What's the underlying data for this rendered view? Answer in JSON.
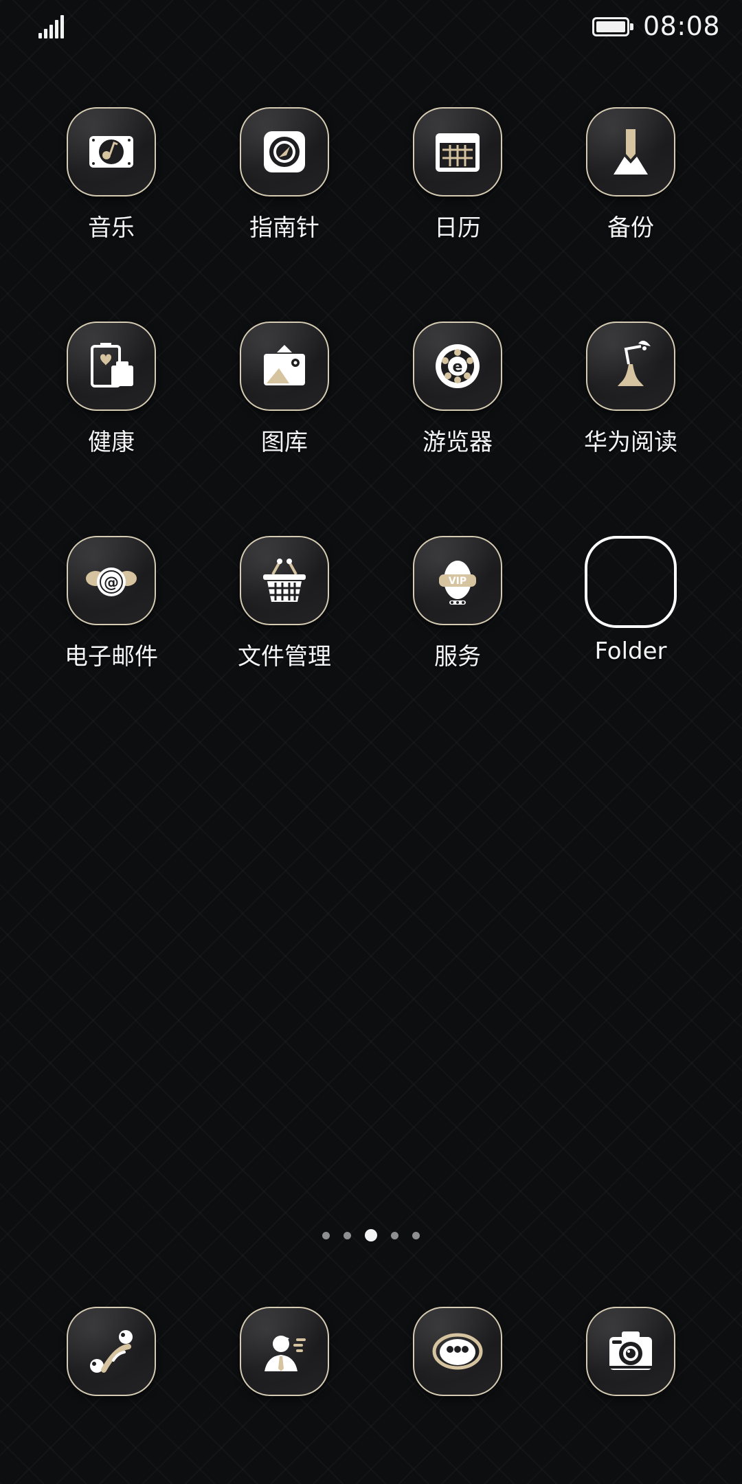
{
  "status_bar": {
    "time": "08:08",
    "signal_icon": "signal-bars-icon",
    "battery_icon": "battery-full-icon"
  },
  "apps": [
    {
      "label": "音乐",
      "icon": "music-icon"
    },
    {
      "label": "指南针",
      "icon": "compass-icon"
    },
    {
      "label": "日历",
      "icon": "calendar-icon"
    },
    {
      "label": "备份",
      "icon": "backup-icon"
    },
    {
      "label": "健康",
      "icon": "health-icon"
    },
    {
      "label": "图库",
      "icon": "gallery-icon"
    },
    {
      "label": "游览器",
      "icon": "browser-icon"
    },
    {
      "label": "华为阅读",
      "icon": "reading-lamp-icon"
    },
    {
      "label": "电子邮件",
      "icon": "email-icon"
    },
    {
      "label": "文件管理",
      "icon": "basket-icon"
    },
    {
      "label": "服务",
      "icon": "vip-service-icon"
    },
    {
      "label": "Folder",
      "icon": "folder-icon"
    }
  ],
  "page_indicator": {
    "count": 5,
    "active_index": 2
  },
  "dock": [
    {
      "icon": "phone-icon"
    },
    {
      "icon": "contacts-icon"
    },
    {
      "icon": "messages-icon"
    },
    {
      "icon": "camera-icon"
    }
  ],
  "colors": {
    "background": "#0d0e10",
    "icon_border": "#d6ccb4",
    "accent_gold": "#d6c3a0",
    "text": "#f5f5f5"
  }
}
